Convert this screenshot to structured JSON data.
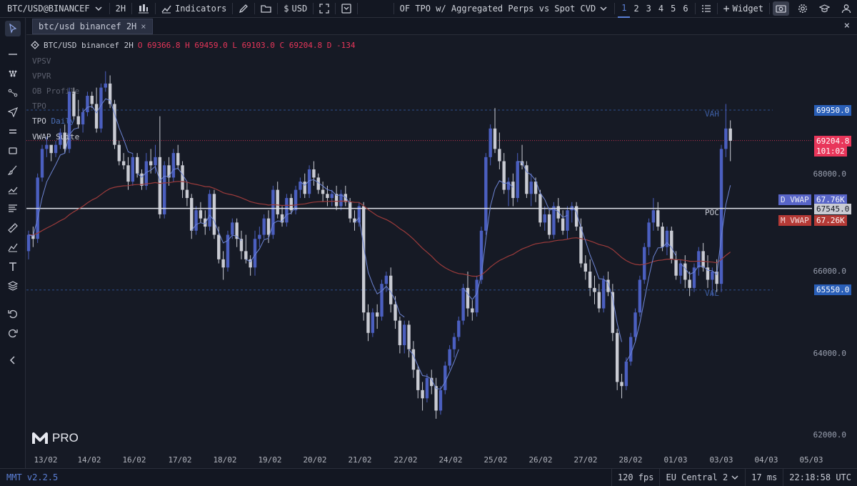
{
  "topbar": {
    "symbol": "BTC/USD@BINANCEF",
    "interval": "2H",
    "indicators_label": "Indicators",
    "currency_label": "USD",
    "template_name": "OF TPO w/ Aggregated Perps vs Spot CVD",
    "layouts": [
      "1",
      "2",
      "3",
      "4",
      "5",
      "6"
    ],
    "widget_label": "Widget"
  },
  "tab": {
    "label": "btc/usd binancef 2H",
    "close": "×"
  },
  "window_close": "×",
  "legend": {
    "symbol": "BTC/USD binancef 2H",
    "o_label": "O",
    "o": "69366.8",
    "h_label": "H",
    "h": "69459.0",
    "l_label": "L",
    "l": "69103.0",
    "c_label": "C",
    "c": "69204.8",
    "d_label": "D",
    "d": "-134"
  },
  "indicators": [
    {
      "label": "VPSV"
    },
    {
      "label": "VPVR"
    },
    {
      "label": "OB Profile"
    },
    {
      "label": "TPO"
    },
    {
      "label": "TPO",
      "sub": "Daily"
    },
    {
      "label": "VWAP Suite"
    }
  ],
  "chart_labels": {
    "vah": "VAH",
    "poc": "POC",
    "val": "VAL"
  },
  "price_axis": {
    "ticks": [
      "68000.0",
      "66000.0",
      "64000.0",
      "62000.0"
    ],
    "vah_price": "69950.0",
    "last_price": "69204.8",
    "countdown": "101:02",
    "poc_price": "67545.0",
    "val_price": "65550.0",
    "d_vwap_label": "D VWAP",
    "d_vwap_value": "67.76K",
    "m_vwap_label": "M VWAP",
    "m_vwap_value": "67.26K"
  },
  "time_axis": [
    "13/02",
    "14/02",
    "16/02",
    "17/02",
    "18/02",
    "19/02",
    "20/02",
    "21/02",
    "22/02",
    "24/02",
    "25/02",
    "26/02",
    "27/02",
    "28/02",
    "01/03",
    "03/03",
    "04/03",
    "05/03"
  ],
  "logo": {
    "text": "PRO"
  },
  "status": {
    "version": "MMT v2.2.5",
    "fps": "120 fps",
    "region": "EU Central 2",
    "latency": "17 ms",
    "clock": "22:18:58 UTC"
  },
  "colors": {
    "bull": "#4b5fc0",
    "bear": "#c9cbd3",
    "last_price": "#e8365a",
    "vah_box": "#2a5fb8",
    "d_vwap_box": "#5865c8",
    "m_vwap_box": "#b53a36"
  },
  "candles": [
    [
      66.5,
      67.0,
      66.3,
      66.9
    ],
    [
      66.9,
      67.1,
      66.6,
      66.8
    ],
    [
      66.8,
      68.4,
      66.7,
      68.3
    ],
    [
      68.3,
      69.1,
      68.2,
      69.0
    ],
    [
      69.0,
      69.3,
      68.8,
      69.1
    ],
    [
      69.1,
      69.0,
      68.7,
      68.9
    ],
    [
      68.9,
      69.2,
      68.8,
      69.1
    ],
    [
      69.1,
      69.5,
      69.0,
      69.4
    ],
    [
      69.4,
      69.6,
      68.9,
      69.0
    ],
    [
      69.0,
      70.5,
      68.9,
      70.4
    ],
    [
      70.4,
      70.5,
      69.7,
      69.8
    ],
    [
      69.8,
      70.2,
      69.5,
      69.6
    ],
    [
      69.6,
      70.0,
      69.4,
      69.9
    ],
    [
      69.9,
      70.4,
      69.8,
      70.3
    ],
    [
      70.3,
      70.4,
      70.0,
      70.1
    ],
    [
      70.1,
      70.5,
      69.4,
      69.5
    ],
    [
      69.5,
      70.6,
      69.4,
      70.5
    ],
    [
      70.5,
      70.9,
      70.4,
      70.6
    ],
    [
      70.6,
      70.8,
      70.0,
      70.1
    ],
    [
      70.1,
      70.2,
      69.0,
      69.1
    ],
    [
      69.1,
      69.2,
      68.6,
      68.7
    ],
    [
      68.7,
      68.9,
      68.5,
      68.6
    ],
    [
      68.6,
      68.8,
      68.0,
      68.2
    ],
    [
      68.2,
      68.9,
      68.1,
      68.8
    ],
    [
      68.8,
      68.9,
      68.3,
      68.4
    ],
    [
      68.4,
      68.5,
      68.0,
      68.1
    ],
    [
      68.1,
      68.9,
      68.0,
      68.7
    ],
    [
      68.7,
      69.0,
      68.4,
      68.6
    ],
    [
      68.6,
      69.1,
      68.4,
      68.8
    ],
    [
      68.8,
      69.8,
      67.3,
      67.4
    ],
    [
      67.4,
      68.7,
      67.3,
      68.6
    ],
    [
      68.6,
      68.8,
      68.1,
      68.3
    ],
    [
      68.3,
      69.0,
      68.2,
      68.9
    ],
    [
      68.9,
      69.1,
      68.5,
      68.6
    ],
    [
      68.6,
      68.7,
      67.8,
      68.0
    ],
    [
      68.0,
      68.2,
      67.6,
      67.8
    ],
    [
      67.8,
      67.9,
      66.8,
      67.0
    ],
    [
      67.0,
      67.6,
      66.9,
      67.5
    ],
    [
      67.5,
      67.7,
      67.2,
      67.3
    ],
    [
      67.3,
      67.5,
      66.9,
      67.1
    ],
    [
      67.1,
      68.0,
      67.0,
      67.9
    ],
    [
      67.9,
      68.0,
      66.8,
      66.9
    ],
    [
      66.9,
      67.1,
      66.2,
      66.3
    ],
    [
      66.3,
      66.5,
      65.8,
      66.1
    ],
    [
      66.1,
      67.0,
      66.0,
      66.9
    ],
    [
      66.9,
      67.3,
      66.8,
      67.2
    ],
    [
      67.2,
      67.3,
      66.6,
      66.8
    ],
    [
      66.8,
      67.0,
      66.3,
      66.5
    ],
    [
      66.5,
      66.9,
      66.2,
      66.3
    ],
    [
      66.3,
      66.4,
      65.9,
      66.1
    ],
    [
      66.1,
      67.0,
      65.9,
      66.8
    ],
    [
      66.8,
      67.1,
      66.6,
      66.9
    ],
    [
      66.9,
      67.4,
      66.8,
      67.3
    ],
    [
      67.3,
      67.5,
      66.7,
      66.9
    ],
    [
      66.9,
      68.1,
      66.8,
      68.0
    ],
    [
      68.0,
      68.2,
      67.3,
      67.4
    ],
    [
      67.4,
      67.6,
      67.1,
      67.2
    ],
    [
      67.2,
      67.9,
      67.1,
      67.8
    ],
    [
      67.8,
      67.9,
      67.4,
      67.5
    ],
    [
      67.5,
      68.1,
      67.4,
      68.0
    ],
    [
      68.0,
      68.3,
      67.8,
      68.2
    ],
    [
      68.2,
      68.4,
      67.8,
      67.9
    ],
    [
      67.9,
      68.6,
      67.8,
      68.5
    ],
    [
      68.5,
      68.7,
      68.1,
      68.3
    ],
    [
      68.3,
      68.4,
      67.9,
      68.0
    ],
    [
      68.0,
      68.2,
      67.7,
      67.9
    ],
    [
      67.9,
      68.1,
      67.6,
      67.8
    ],
    [
      67.8,
      68.0,
      67.6,
      67.9
    ],
    [
      67.9,
      68.1,
      67.5,
      67.6
    ],
    [
      67.6,
      68.0,
      67.5,
      67.9
    ],
    [
      67.9,
      68.1,
      67.6,
      67.7
    ],
    [
      67.7,
      67.8,
      67.2,
      67.3
    ],
    [
      67.3,
      67.5,
      67.0,
      67.2
    ],
    [
      67.2,
      67.7,
      67.1,
      67.6
    ],
    [
      67.6,
      67.7,
      64.8,
      65.0
    ],
    [
      65.0,
      65.2,
      64.3,
      64.5
    ],
    [
      64.5,
      65.1,
      64.4,
      65.0
    ],
    [
      65.0,
      65.2,
      64.6,
      64.9
    ],
    [
      64.9,
      65.8,
      64.8,
      65.7
    ],
    [
      65.7,
      66.0,
      65.5,
      65.9
    ],
    [
      65.9,
      66.1,
      65.0,
      65.2
    ],
    [
      65.2,
      65.4,
      64.6,
      64.8
    ],
    [
      64.8,
      64.9,
      64.0,
      64.2
    ],
    [
      64.2,
      64.8,
      64.0,
      64.7
    ],
    [
      64.7,
      64.8,
      63.9,
      64.1
    ],
    [
      64.1,
      64.3,
      63.4,
      63.6
    ],
    [
      63.6,
      63.7,
      62.9,
      63.1
    ],
    [
      63.1,
      63.3,
      62.6,
      62.9
    ],
    [
      62.9,
      63.5,
      62.8,
      63.4
    ],
    [
      63.4,
      63.6,
      63.0,
      63.2
    ],
    [
      63.2,
      63.4,
      62.4,
      62.6
    ],
    [
      62.6,
      63.2,
      62.5,
      63.1
    ],
    [
      63.1,
      63.8,
      63.0,
      63.7
    ],
    [
      63.7,
      64.2,
      63.6,
      64.1
    ],
    [
      64.1,
      64.5,
      63.9,
      64.4
    ],
    [
      64.4,
      64.9,
      64.3,
      64.8
    ],
    [
      64.8,
      65.7,
      64.7,
      65.6
    ],
    [
      65.6,
      66.0,
      64.9,
      65.1
    ],
    [
      65.1,
      65.3,
      64.8,
      65.0
    ],
    [
      65.0,
      65.9,
      64.9,
      65.8
    ],
    [
      65.8,
      67.1,
      65.7,
      67.0
    ],
    [
      67.0,
      68.9,
      66.9,
      68.8
    ],
    [
      68.8,
      69.6,
      68.6,
      69.5
    ],
    [
      69.5,
      70.0,
      68.9,
      69.0
    ],
    [
      69.0,
      69.4,
      68.5,
      68.7
    ],
    [
      68.7,
      68.9,
      67.9,
      68.0
    ],
    [
      68.0,
      68.3,
      67.6,
      68.2
    ],
    [
      68.2,
      68.4,
      67.6,
      67.8
    ],
    [
      67.8,
      68.9,
      67.7,
      68.7
    ],
    [
      68.7,
      69.1,
      68.5,
      68.6
    ],
    [
      68.6,
      68.7,
      67.8,
      67.9
    ],
    [
      67.9,
      68.4,
      67.6,
      68.2
    ],
    [
      68.2,
      68.3,
      67.7,
      67.9
    ],
    [
      67.9,
      68.0,
      67.1,
      67.2
    ],
    [
      67.2,
      67.6,
      67.0,
      67.4
    ],
    [
      67.4,
      67.5,
      66.8,
      66.9
    ],
    [
      66.9,
      67.7,
      66.8,
      67.6
    ],
    [
      67.6,
      67.8,
      67.2,
      67.3
    ],
    [
      67.3,
      67.5,
      66.9,
      67.0
    ],
    [
      67.0,
      67.6,
      66.8,
      67.5
    ],
    [
      67.5,
      67.7,
      67.2,
      67.6
    ],
    [
      67.6,
      67.7,
      67.0,
      67.1
    ],
    [
      67.1,
      67.3,
      66.1,
      66.2
    ],
    [
      66.2,
      66.4,
      65.8,
      66.0
    ],
    [
      66.0,
      66.3,
      65.4,
      65.6
    ],
    [
      65.6,
      65.9,
      65.2,
      65.5
    ],
    [
      65.5,
      65.7,
      65.0,
      65.1
    ],
    [
      65.1,
      65.9,
      65.0,
      65.8
    ],
    [
      65.8,
      66.0,
      65.4,
      65.5
    ],
    [
      65.5,
      65.7,
      64.3,
      64.5
    ],
    [
      64.5,
      64.6,
      63.1,
      63.3
    ],
    [
      63.3,
      63.5,
      62.9,
      63.2
    ],
    [
      63.2,
      63.9,
      63.1,
      63.8
    ],
    [
      63.8,
      64.5,
      63.7,
      64.4
    ],
    [
      64.4,
      65.1,
      64.3,
      65.0
    ],
    [
      65.0,
      65.9,
      64.9,
      65.8
    ],
    [
      65.8,
      66.7,
      65.7,
      66.6
    ],
    [
      66.6,
      67.3,
      66.4,
      67.2
    ],
    [
      67.2,
      67.8,
      67.0,
      67.5
    ],
    [
      67.5,
      67.7,
      67.0,
      67.1
    ],
    [
      67.1,
      67.2,
      66.5,
      66.6
    ],
    [
      66.6,
      67.1,
      66.4,
      67.0
    ],
    [
      67.0,
      67.1,
      66.2,
      66.3
    ],
    [
      66.3,
      66.5,
      65.8,
      65.9
    ],
    [
      65.9,
      66.3,
      65.7,
      66.2
    ],
    [
      66.2,
      66.4,
      65.6,
      65.8
    ],
    [
      65.8,
      66.0,
      65.4,
      65.6
    ],
    [
      65.6,
      66.2,
      65.5,
      66.1
    ],
    [
      66.1,
      66.6,
      65.9,
      66.5
    ],
    [
      66.5,
      66.7,
      66.0,
      66.1
    ],
    [
      66.1,
      66.4,
      65.6,
      65.8
    ],
    [
      65.8,
      66.1,
      65.4,
      66.0
    ],
    [
      66.0,
      66.3,
      65.5,
      65.7
    ],
    [
      65.7,
      69.1,
      65.5,
      69.0
    ],
    [
      69.0,
      70.1,
      68.8,
      69.5
    ],
    [
      69.5,
      69.7,
      68.7,
      69.2
    ]
  ]
}
